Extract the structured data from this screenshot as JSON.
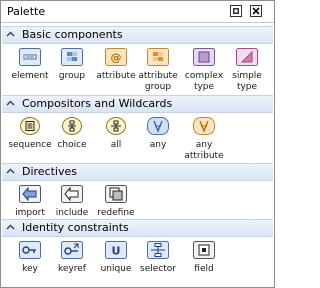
{
  "window": {
    "title": "Palette"
  },
  "sections": [
    {
      "label": "Basic components",
      "items": [
        {
          "label": "element",
          "icon": "element-icon"
        },
        {
          "label": "group",
          "icon": "group-icon"
        },
        {
          "label": "attribute",
          "icon": "attribute-icon"
        },
        {
          "label": "attribute group",
          "icon": "attribute-group-icon"
        },
        {
          "label": "complex type",
          "icon": "complex-type-icon"
        },
        {
          "label": "simple type",
          "icon": "simple-type-icon"
        }
      ]
    },
    {
      "label": "Compositors and Wildcards",
      "items": [
        {
          "label": "sequence",
          "icon": "sequence-icon"
        },
        {
          "label": "choice",
          "icon": "choice-icon"
        },
        {
          "label": "all",
          "icon": "all-icon"
        },
        {
          "label": "any",
          "icon": "any-icon"
        },
        {
          "label": "any attribute",
          "icon": "any-attribute-icon"
        }
      ]
    },
    {
      "label": "Directives",
      "items": [
        {
          "label": "import",
          "icon": "import-icon"
        },
        {
          "label": "include",
          "icon": "include-icon"
        },
        {
          "label": "redefine",
          "icon": "redefine-icon"
        }
      ]
    },
    {
      "label": "Identity constraints",
      "items": [
        {
          "label": "key",
          "icon": "key-icon"
        },
        {
          "label": "keyref",
          "icon": "keyref-icon"
        },
        {
          "label": "unique",
          "icon": "unique-icon"
        },
        {
          "label": "selector",
          "icon": "selector-icon"
        },
        {
          "label": "field",
          "icon": "field-icon"
        }
      ]
    }
  ],
  "colors": {
    "section_header": "#dde7f4",
    "element_fill": "#dfe9f7",
    "attribute_fill": "#fbe4c0",
    "complex_fill": "#e6d9f0",
    "simple_fill": "#f7dcee",
    "compositor_fill": "#fff4c8",
    "wildcard_fill": "#cfe0f7"
  }
}
